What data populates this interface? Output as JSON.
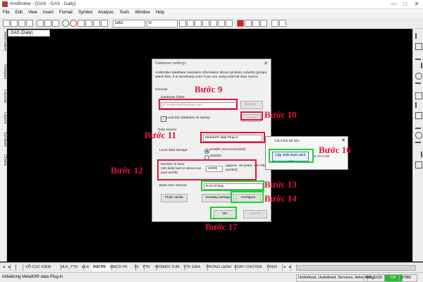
{
  "window": {
    "title": "AmiBroker - [GAS - GAS - Daily]",
    "controls": [
      "—",
      "□",
      "✕"
    ]
  },
  "menu": [
    "File",
    "Edit",
    "View",
    "Insert",
    "Format",
    "Symbol",
    "Analysis",
    "Tools",
    "Window",
    "Help"
  ],
  "toolbar": {
    "symbol": "GAS",
    "interval": "D"
  },
  "left_tabs": [
    "Information",
    "Notepad",
    "Layouts",
    "Layers",
    "Symbols",
    "Charts"
  ],
  "doc_tab": "GAS (Daily)",
  "dialog": {
    "title": "Database settings",
    "intro": "AmiBroker database maintains information about symbols, industry groups, watch lists. It is necessary even if you are using external data source.",
    "general": "General",
    "db_folder_label": "Database folder:",
    "db_folder_value": "E:\\AmiBroker\\hududo.com",
    "browse": "Browse...",
    "load_startup": "Load this database at startup",
    "create": "Create",
    "data_source_label": "Data source:",
    "data_source_value": "MetaKit® data Plug-in",
    "local_storage_label": "Local data storage:",
    "enable": "Enable (recommended)",
    "disable": "Disable",
    "bars_label": "Number of bars:",
    "bars_note": "260 daily bars is about one year worth)",
    "bars_value": "10000",
    "bars_approx": "(approx. 38 years, 390 KB per symbol)",
    "base_interval_label": "Base time interval:",
    "base_interval_value": "End-Of-Day",
    "flush": "Flush cache",
    "intraday": "Intraday settings",
    "configure": "Configure",
    "ok": "OK",
    "cancel": "Cancel"
  },
  "subdialog": {
    "title": "Cấu hình dữ liệu",
    "button": "Cập nhật danh sách mã",
    "side_text": "én có 6 mã"
  },
  "steps": {
    "s9": "Bước 9",
    "s10": "Bước 10",
    "s11": "Bước 11",
    "s12": "Bước 12",
    "s13": "Bước 13",
    "s14": "Bước 14",
    "s16": "Bước 16",
    "s17": "Bước 17"
  },
  "sheet_tabs": [
    "VÕ CUC KIEM",
    "HLK_YTK",
    "HLK",
    "RSI PK",
    "MACD PK",
    "TK",
    "YTK",
    "MOMEN TUM",
    "YTK EMA",
    "TRONG LENH",
    "XOAY CHUYEN",
    "TREN"
  ],
  "active_sheet": "RSI PK",
  "status": {
    "message": "Initializing MetaKit® data Plug-in",
    "info": "Undefined, Undefined, Services, Advertising",
    "plugin": "IFT_EOD",
    "ok": "OK",
    "mem": "378M"
  },
  "colors": {
    "step_label": "#e0133c",
    "red_box": "#e2153d",
    "green_box": "#19d52d",
    "ok_status": "#1fbf2f"
  }
}
